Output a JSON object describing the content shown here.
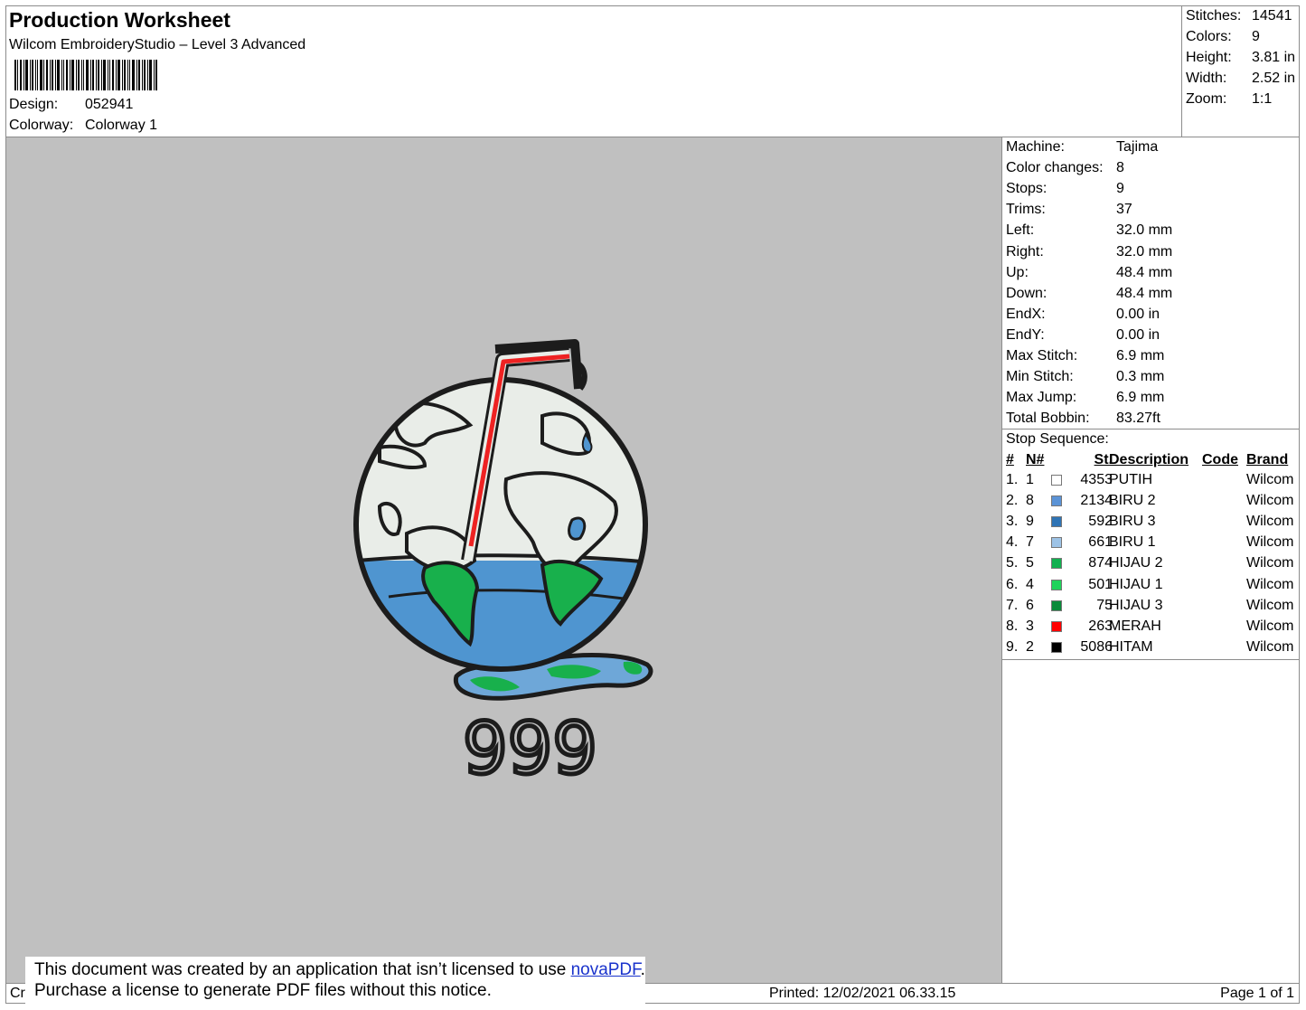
{
  "header": {
    "title": "Production Worksheet",
    "software": "Wilcom EmbroideryStudio – Level 3 Advanced",
    "design_label": "Design:",
    "design_value": "052941",
    "colorway_label": "Colorway:",
    "colorway_value": "Colorway 1"
  },
  "summary": {
    "stitches_label": "Stitches:",
    "stitches_value": "14541",
    "colors_label": "Colors:",
    "colors_value": "9",
    "height_label": "Height:",
    "height_value": "3.81 in",
    "width_label": "Width:",
    "width_value": "2.52 in",
    "zoom_label": "Zoom:",
    "zoom_value": "1:1"
  },
  "stats": [
    {
      "label": "Machine:",
      "value": "Tajima"
    },
    {
      "label": "Color changes:",
      "value": "8"
    },
    {
      "label": "Stops:",
      "value": "9"
    },
    {
      "label": "Trims:",
      "value": "37"
    },
    {
      "label": "Left:",
      "value": "32.0 mm"
    },
    {
      "label": "Right:",
      "value": "32.0 mm"
    },
    {
      "label": "Up:",
      "value": "48.4 mm"
    },
    {
      "label": "Down:",
      "value": "48.4 mm"
    },
    {
      "label": "EndX:",
      "value": "0.00 in"
    },
    {
      "label": "EndY:",
      "value": "0.00 in"
    },
    {
      "label": "Max Stitch:",
      "value": "6.9 mm"
    },
    {
      "label": "Min Stitch:",
      "value": "0.3 mm"
    },
    {
      "label": "Max Jump:",
      "value": "6.9 mm"
    },
    {
      "label": "Total Bobbin:",
      "value": "83.27ft"
    }
  ],
  "stop_sequence": {
    "title": "Stop Sequence:",
    "headers": {
      "idx": "#",
      "n": "N#",
      "st": "St.",
      "desc": "Description",
      "code": "Code",
      "brand": "Brand"
    },
    "rows": [
      {
        "idx": "1.",
        "n": "1",
        "color": "#ffffff",
        "st": "4353",
        "desc": "PUTIH",
        "code": "",
        "brand": "Wilcom"
      },
      {
        "idx": "2.",
        "n": "8",
        "color": "#5b93d6",
        "st": "2134",
        "desc": "BIRU 2",
        "code": "",
        "brand": "Wilcom"
      },
      {
        "idx": "3.",
        "n": "9",
        "color": "#2f74b5",
        "st": "592",
        "desc": "BIRU 3",
        "code": "",
        "brand": "Wilcom"
      },
      {
        "idx": "4.",
        "n": "7",
        "color": "#9dc3e6",
        "st": "661",
        "desc": "BIRU 1",
        "code": "",
        "brand": "Wilcom"
      },
      {
        "idx": "5.",
        "n": "5",
        "color": "#12b050",
        "st": "874",
        "desc": "HIJAU 2",
        "code": "",
        "brand": "Wilcom"
      },
      {
        "idx": "6.",
        "n": "4",
        "color": "#1fd35b",
        "st": "501",
        "desc": "HIJAU 1",
        "code": "",
        "brand": "Wilcom"
      },
      {
        "idx": "7.",
        "n": "6",
        "color": "#0a8a3a",
        "st": "75",
        "desc": "HIJAU 3",
        "code": "",
        "brand": "Wilcom"
      },
      {
        "idx": "8.",
        "n": "3",
        "color": "#ff0000",
        "st": "263",
        "desc": "MERAH",
        "code": "",
        "brand": "Wilcom"
      },
      {
        "idx": "9.",
        "n": "2",
        "color": "#000000",
        "st": "5086",
        "desc": "HITAM",
        "code": "",
        "brand": "Wilcom"
      }
    ]
  },
  "footer": {
    "created_by": "Cr",
    "printed": "Printed: 12/02/2021 06.33.15",
    "page": "Page 1 of 1"
  },
  "notice": {
    "line1_prefix": "This document was created by an application that isn’t licensed to use ",
    "link": "novaPDF",
    "line1_suffix": ".",
    "line2": "Purchase a license to generate PDF files without this notice."
  },
  "design_art": {
    "text": "999"
  }
}
